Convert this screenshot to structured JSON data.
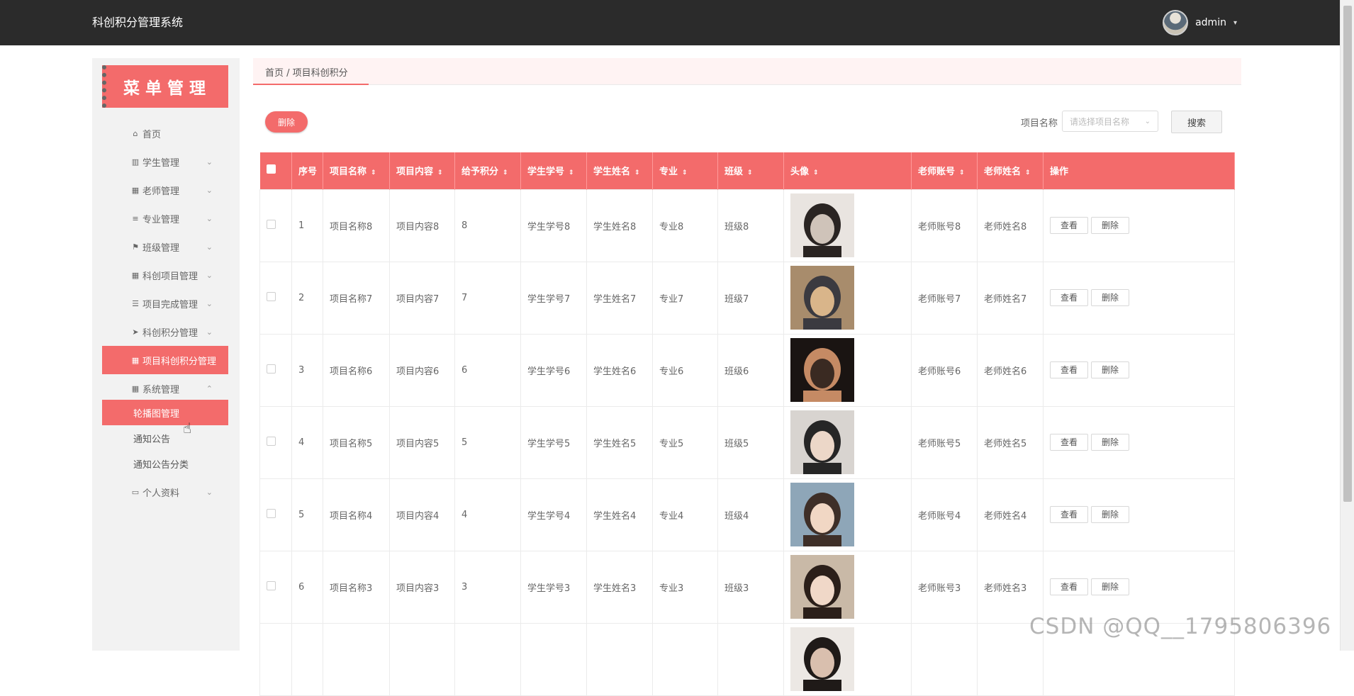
{
  "header": {
    "app_title": "科创积分管理系统",
    "user_name": "admin",
    "user_caret": "▾"
  },
  "sidebar": {
    "banner": "菜单管理",
    "items": [
      {
        "label": "首页",
        "icon": "home-icon",
        "glyph": "⌂",
        "chevron": ""
      },
      {
        "label": "学生管理",
        "icon": "bar-chart-icon",
        "glyph": "▥",
        "chevron": "⌄"
      },
      {
        "label": "老师管理",
        "icon": "grid-icon",
        "glyph": "▦",
        "chevron": "⌄"
      },
      {
        "label": "专业管理",
        "icon": "list-icon",
        "glyph": "≡",
        "chevron": "⌄"
      },
      {
        "label": "班级管理",
        "icon": "flag-icon",
        "glyph": "⚑",
        "chevron": "⌄"
      },
      {
        "label": "科创项目管理",
        "icon": "grid-icon",
        "glyph": "▦",
        "chevron": "⌄"
      },
      {
        "label": "项目完成管理",
        "icon": "list-icon",
        "glyph": "☰",
        "chevron": "⌄"
      },
      {
        "label": "科创积分管理",
        "icon": "send-icon",
        "glyph": "➤",
        "chevron": "⌄"
      },
      {
        "label": "项目科创积分管理",
        "icon": "grid-icon",
        "glyph": "▦",
        "chevron": ""
      },
      {
        "label": "系统管理",
        "icon": "grid-icon",
        "glyph": "▦",
        "chevron": "⌃"
      }
    ],
    "sub_items": [
      {
        "label": "轮播图管理"
      },
      {
        "label": "通知公告"
      },
      {
        "label": "通知公告分类"
      }
    ],
    "profile_item": {
      "label": "个人资料",
      "icon": "card-icon",
      "glyph": "▭",
      "chevron": "⌄"
    }
  },
  "breadcrumb": "首页 / 项目科创积分",
  "toolbar": {
    "delete_label": "删除",
    "search_label": "项目名称",
    "search_placeholder": "请选择项目名称",
    "search_button": "搜索"
  },
  "table": {
    "columns": [
      "序号",
      "项目名称",
      "项目内容",
      "给予积分",
      "学生学号",
      "学生姓名",
      "专业",
      "班级",
      "头像",
      "老师账号",
      "老师姓名",
      "操作"
    ],
    "sortable": [
      false,
      true,
      true,
      true,
      true,
      true,
      true,
      true,
      true,
      true,
      true,
      false
    ],
    "sort_glyph": "⇕",
    "view_label": "查看",
    "delete_label": "删除",
    "rows": [
      {
        "no": "1",
        "name": "项目名称8",
        "content": "项目内容8",
        "points": "8",
        "student_id": "学生学号8",
        "student_name": "学生姓名8",
        "major": "专业8",
        "class": "班级8",
        "teacher_account": "老师账号8",
        "teacher_name": "老师姓名8",
        "photo_colors": [
          "#e9e4e0",
          "#2a2422",
          "#cfc3b9"
        ]
      },
      {
        "no": "2",
        "name": "项目名称7",
        "content": "项目内容7",
        "points": "7",
        "student_id": "学生学号7",
        "student_name": "学生姓名7",
        "major": "专业7",
        "class": "班级7",
        "teacher_account": "老师账号7",
        "teacher_name": "老师姓名7",
        "photo_colors": [
          "#a88c6c",
          "#3b3a40",
          "#d9b58a"
        ]
      },
      {
        "no": "3",
        "name": "项目名称6",
        "content": "项目内容6",
        "points": "6",
        "student_id": "学生学号6",
        "student_name": "学生姓名6",
        "major": "专业6",
        "class": "班级6",
        "teacher_account": "老师账号6",
        "teacher_name": "老师姓名6",
        "photo_colors": [
          "#1a1412",
          "#c58a64",
          "#3a2a22"
        ]
      },
      {
        "no": "4",
        "name": "项目名称5",
        "content": "项目内容5",
        "points": "5",
        "student_id": "学生学号5",
        "student_name": "学生姓名5",
        "major": "专业5",
        "class": "班级5",
        "teacher_account": "老师账号5",
        "teacher_name": "老师姓名5",
        "photo_colors": [
          "#d8d4d0",
          "#262626",
          "#ecd7c8"
        ]
      },
      {
        "no": "5",
        "name": "项目名称4",
        "content": "项目内容4",
        "points": "4",
        "student_id": "学生学号4",
        "student_name": "学生姓名4",
        "major": "专业4",
        "class": "班级4",
        "teacher_account": "老师账号4",
        "teacher_name": "老师姓名4",
        "photo_colors": [
          "#8ea6b8",
          "#3e2f28",
          "#f1d7c4"
        ]
      },
      {
        "no": "6",
        "name": "项目名称3",
        "content": "项目内容3",
        "points": "3",
        "student_id": "学生学号3",
        "student_name": "学生姓名3",
        "major": "专业3",
        "class": "班级3",
        "teacher_account": "老师账号3",
        "teacher_name": "老师姓名3",
        "photo_colors": [
          "#c9b9a7",
          "#2b1f1a",
          "#f0d8c8"
        ]
      },
      {
        "no": "",
        "name": "",
        "content": "",
        "points": "",
        "student_id": "",
        "student_name": "",
        "major": "",
        "class": "",
        "teacher_account": "",
        "teacher_name": "",
        "photo_colors": [
          "#ece8e4",
          "#1f1a18",
          "#d9bfae"
        ]
      }
    ]
  },
  "watermark": "CSDN @QQ__1795806396",
  "colors": {
    "accent": "#f36b6b",
    "topbar": "#2b2b2b",
    "sidebar_bg": "#f2f2f2"
  }
}
